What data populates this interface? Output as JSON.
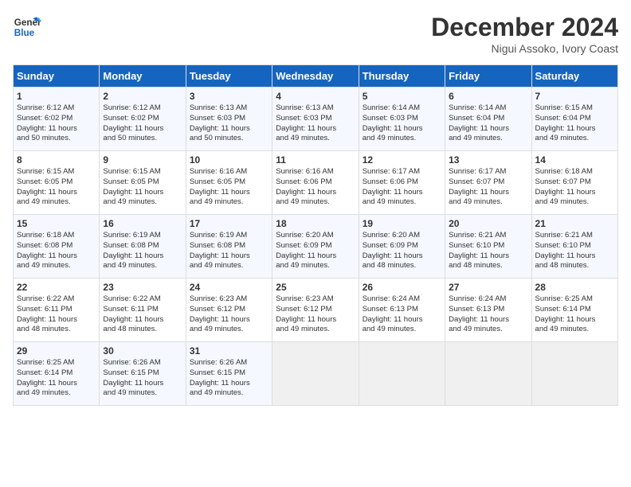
{
  "logo": {
    "line1": "General",
    "line2": "Blue"
  },
  "calendar": {
    "title": "December 2024",
    "subtitle": "Nigui Assoko, Ivory Coast"
  },
  "headers": [
    "Sunday",
    "Monday",
    "Tuesday",
    "Wednesday",
    "Thursday",
    "Friday",
    "Saturday"
  ],
  "weeks": [
    [
      {
        "day": "1",
        "info": "Sunrise: 6:12 AM\nSunset: 6:02 PM\nDaylight: 11 hours\nand 50 minutes."
      },
      {
        "day": "2",
        "info": "Sunrise: 6:12 AM\nSunset: 6:02 PM\nDaylight: 11 hours\nand 50 minutes."
      },
      {
        "day": "3",
        "info": "Sunrise: 6:13 AM\nSunset: 6:03 PM\nDaylight: 11 hours\nand 50 minutes."
      },
      {
        "day": "4",
        "info": "Sunrise: 6:13 AM\nSunset: 6:03 PM\nDaylight: 11 hours\nand 49 minutes."
      },
      {
        "day": "5",
        "info": "Sunrise: 6:14 AM\nSunset: 6:03 PM\nDaylight: 11 hours\nand 49 minutes."
      },
      {
        "day": "6",
        "info": "Sunrise: 6:14 AM\nSunset: 6:04 PM\nDaylight: 11 hours\nand 49 minutes."
      },
      {
        "day": "7",
        "info": "Sunrise: 6:15 AM\nSunset: 6:04 PM\nDaylight: 11 hours\nand 49 minutes."
      }
    ],
    [
      {
        "day": "8",
        "info": "Sunrise: 6:15 AM\nSunset: 6:05 PM\nDaylight: 11 hours\nand 49 minutes."
      },
      {
        "day": "9",
        "info": "Sunrise: 6:15 AM\nSunset: 6:05 PM\nDaylight: 11 hours\nand 49 minutes."
      },
      {
        "day": "10",
        "info": "Sunrise: 6:16 AM\nSunset: 6:05 PM\nDaylight: 11 hours\nand 49 minutes."
      },
      {
        "day": "11",
        "info": "Sunrise: 6:16 AM\nSunset: 6:06 PM\nDaylight: 11 hours\nand 49 minutes."
      },
      {
        "day": "12",
        "info": "Sunrise: 6:17 AM\nSunset: 6:06 PM\nDaylight: 11 hours\nand 49 minutes."
      },
      {
        "day": "13",
        "info": "Sunrise: 6:17 AM\nSunset: 6:07 PM\nDaylight: 11 hours\nand 49 minutes."
      },
      {
        "day": "14",
        "info": "Sunrise: 6:18 AM\nSunset: 6:07 PM\nDaylight: 11 hours\nand 49 minutes."
      }
    ],
    [
      {
        "day": "15",
        "info": "Sunrise: 6:18 AM\nSunset: 6:08 PM\nDaylight: 11 hours\nand 49 minutes."
      },
      {
        "day": "16",
        "info": "Sunrise: 6:19 AM\nSunset: 6:08 PM\nDaylight: 11 hours\nand 49 minutes."
      },
      {
        "day": "17",
        "info": "Sunrise: 6:19 AM\nSunset: 6:08 PM\nDaylight: 11 hours\nand 49 minutes."
      },
      {
        "day": "18",
        "info": "Sunrise: 6:20 AM\nSunset: 6:09 PM\nDaylight: 11 hours\nand 49 minutes."
      },
      {
        "day": "19",
        "info": "Sunrise: 6:20 AM\nSunset: 6:09 PM\nDaylight: 11 hours\nand 48 minutes."
      },
      {
        "day": "20",
        "info": "Sunrise: 6:21 AM\nSunset: 6:10 PM\nDaylight: 11 hours\nand 48 minutes."
      },
      {
        "day": "21",
        "info": "Sunrise: 6:21 AM\nSunset: 6:10 PM\nDaylight: 11 hours\nand 48 minutes."
      }
    ],
    [
      {
        "day": "22",
        "info": "Sunrise: 6:22 AM\nSunset: 6:11 PM\nDaylight: 11 hours\nand 48 minutes."
      },
      {
        "day": "23",
        "info": "Sunrise: 6:22 AM\nSunset: 6:11 PM\nDaylight: 11 hours\nand 48 minutes."
      },
      {
        "day": "24",
        "info": "Sunrise: 6:23 AM\nSunset: 6:12 PM\nDaylight: 11 hours\nand 49 minutes."
      },
      {
        "day": "25",
        "info": "Sunrise: 6:23 AM\nSunset: 6:12 PM\nDaylight: 11 hours\nand 49 minutes."
      },
      {
        "day": "26",
        "info": "Sunrise: 6:24 AM\nSunset: 6:13 PM\nDaylight: 11 hours\nand 49 minutes."
      },
      {
        "day": "27",
        "info": "Sunrise: 6:24 AM\nSunset: 6:13 PM\nDaylight: 11 hours\nand 49 minutes."
      },
      {
        "day": "28",
        "info": "Sunrise: 6:25 AM\nSunset: 6:14 PM\nDaylight: 11 hours\nand 49 minutes."
      }
    ],
    [
      {
        "day": "29",
        "info": "Sunrise: 6:25 AM\nSunset: 6:14 PM\nDaylight: 11 hours\nand 49 minutes."
      },
      {
        "day": "30",
        "info": "Sunrise: 6:26 AM\nSunset: 6:15 PM\nDaylight: 11 hours\nand 49 minutes."
      },
      {
        "day": "31",
        "info": "Sunrise: 6:26 AM\nSunset: 6:15 PM\nDaylight: 11 hours\nand 49 minutes."
      },
      {
        "day": "",
        "info": ""
      },
      {
        "day": "",
        "info": ""
      },
      {
        "day": "",
        "info": ""
      },
      {
        "day": "",
        "info": ""
      }
    ]
  ]
}
